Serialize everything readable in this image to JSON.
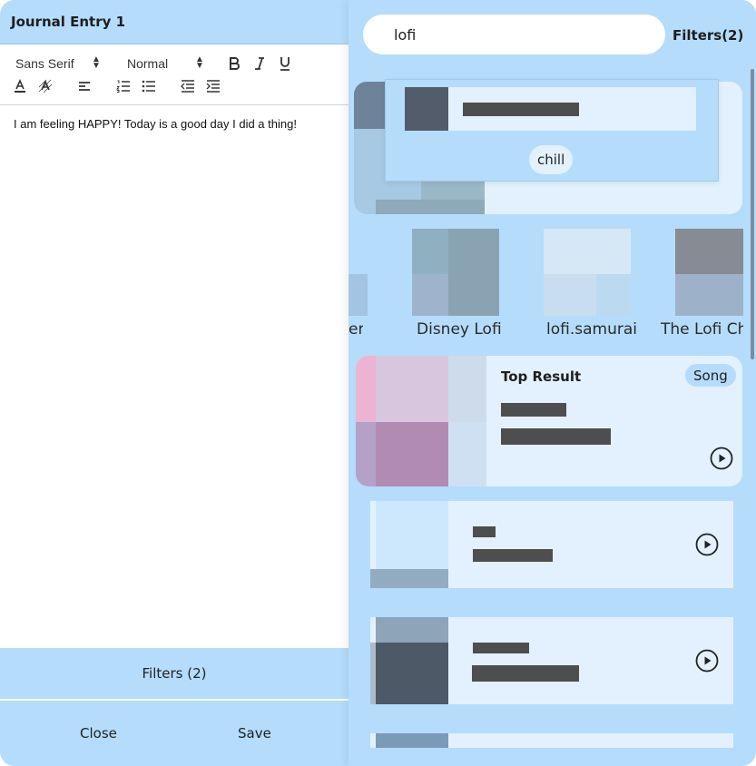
{
  "editor": {
    "title": "Journal Entry 1",
    "font_family_select": "Sans Serif",
    "font_size_select": "Normal",
    "body_text": "I am feeling HAPPY! Today is a good day I did a thing!",
    "filters_label": "Filters (2)",
    "close_label": "Close",
    "save_label": "Save"
  },
  "search": {
    "query": "lofi",
    "filters_label": "Filters(2)",
    "suggestion_chip": "chill"
  },
  "artists": [
    {
      "label": "er"
    },
    {
      "label": "Disney Lofi"
    },
    {
      "label": "lofi.samurai"
    },
    {
      "label": "The Lofi Ch"
    }
  ],
  "top_result": {
    "title": "Top Result",
    "badge": "Song"
  },
  "colors": {
    "panel_bg": "#b5dcfb",
    "card_bg": "#e2f1fd",
    "placeholder_bar": "#4e4e4e"
  }
}
